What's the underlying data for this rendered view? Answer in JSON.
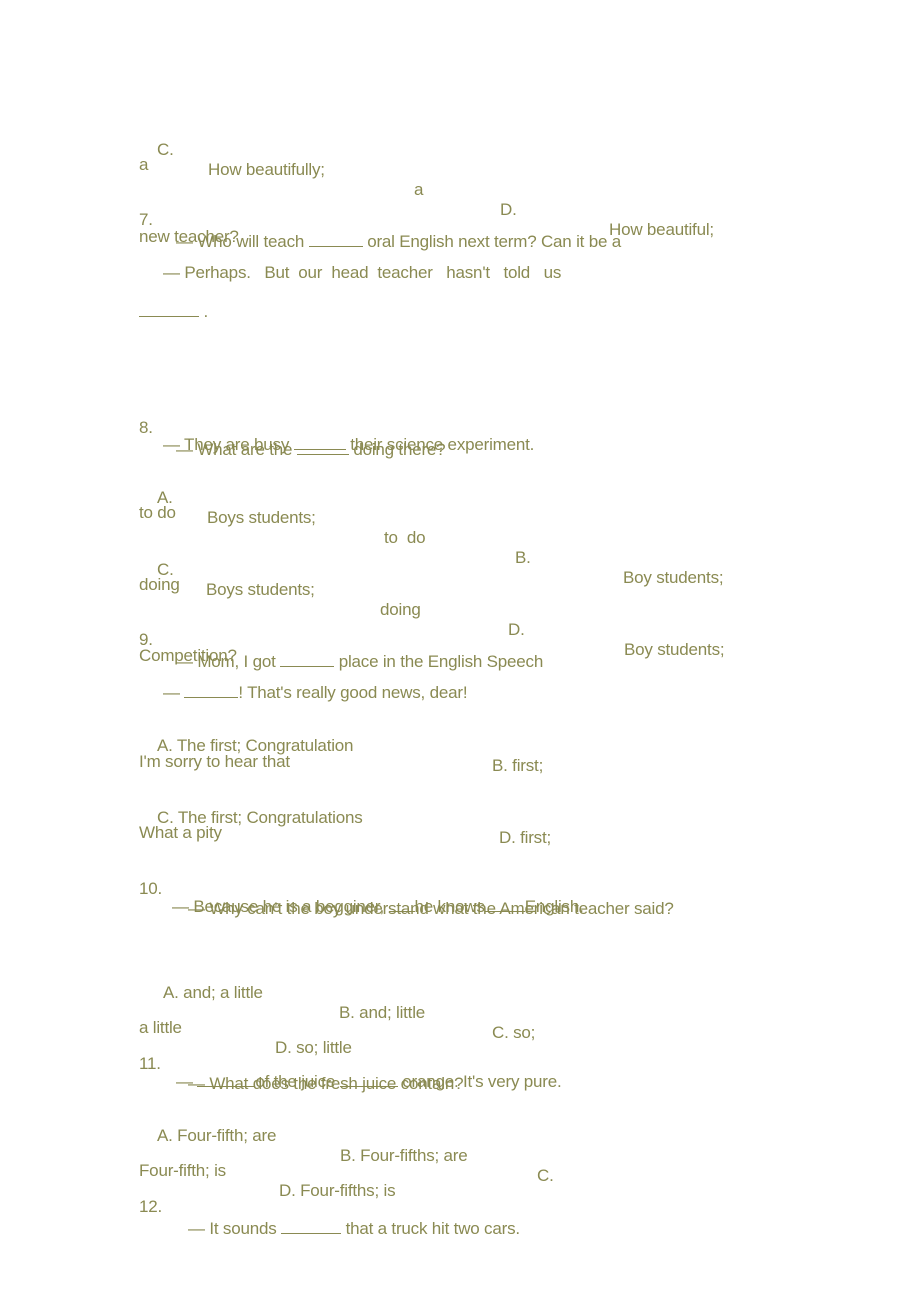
{
  "document": {
    "text_color": "#8a8a52",
    "lines": {
      "l1": {
        "c_label": "C.",
        "c_text": "How beautifully;",
        "c_tail": "a",
        "d_label": "D.",
        "d_text": "How beautiful;"
      },
      "l2": "a",
      "q7": {
        "num": "7.",
        "pre": "— Who will teach",
        "post": "oral English next term? Can it be a"
      },
      "l4": "new teacher?",
      "l5": "— Perhaps.   But  our  head  teacher   hasn't   told   us",
      "l6_post": " .",
      "q8": {
        "num": "8.",
        "pre": "— What are the",
        "post": "doing there?"
      },
      "q8b": {
        "pre": "— They are busy",
        "post": "their science experiment."
      },
      "q8A": {
        "label": "A.",
        "text": "Boys students;",
        "tail": "to  do",
        "b_label": "B.",
        "b_text": "Boy students;"
      },
      "q8A2": "to do",
      "q8C": {
        "label": "C.",
        "text": "Boys students;",
        "tail": "doing",
        "d_label": "D.",
        "d_text": "Boy students;"
      },
      "q8C2": "doing",
      "q9": {
        "num": "9.",
        "pre": "— Mom, I got",
        "post": "place in the English Speech"
      },
      "q9b": "Competition?",
      "q9c": {
        "pre": "—",
        "post": "! That's really good news, dear!"
      },
      "q9A": {
        "a": "A. The first; Congratulation",
        "b": "B. first;"
      },
      "q9A2": "I'm sorry to hear that",
      "q9C": {
        "c": "C. The first; Congratulations",
        "d": "D. first;"
      },
      "q9C2": "What a pity",
      "q10": {
        "num": "10.",
        "text": "— Why can’t the boy understand what the American teacher said?"
      },
      "q10b": {
        "pre": "— Because he is a begginer,",
        "mid": "he knows",
        "post": "English."
      },
      "q10A": {
        "a": "A. and; a little",
        "b": "B. and; little",
        "c": "C. so;"
      },
      "q10A2": {
        "a": "a little",
        "d": "D. so; little"
      },
      "q11": {
        "num": "11.",
        "text": "— What does the fresh juice contain?"
      },
      "q11b": {
        "pre": "—",
        "mid": "of the juice",
        "post": "orange. It's very pure."
      },
      "q11A": {
        "a": "A. Four-fifth; are",
        "b": "B. Four-fifths; are",
        "c": "C."
      },
      "q11A2": {
        "c": "Four-fifth; is",
        "d": "D. Four-fifths; is"
      },
      "q12": {
        "num": "12.",
        "pre": "— It sounds",
        "post": "that a truck hit two cars."
      }
    }
  }
}
